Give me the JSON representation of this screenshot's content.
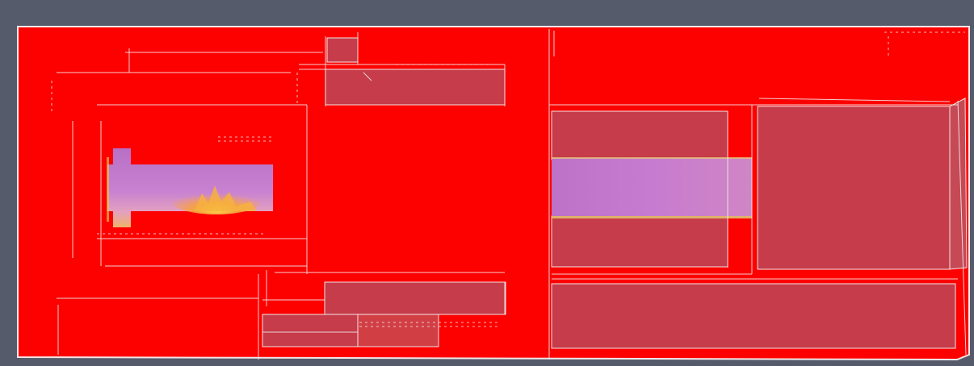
{
  "viewport": {
    "background_color": "#565b6c"
  },
  "render": {
    "mesh_fill_color": "#fd0000",
    "translucent_panel_color": "#c63c4a",
    "plume_colors": [
      "#b86fc6",
      "#c57acb",
      "#d68ac9",
      "#e9a0a8",
      "#f7c060",
      "#ffe44a",
      "#ff8a2a"
    ],
    "edge_color": "#f3e6e6",
    "icon": "3d-mesh-render"
  }
}
